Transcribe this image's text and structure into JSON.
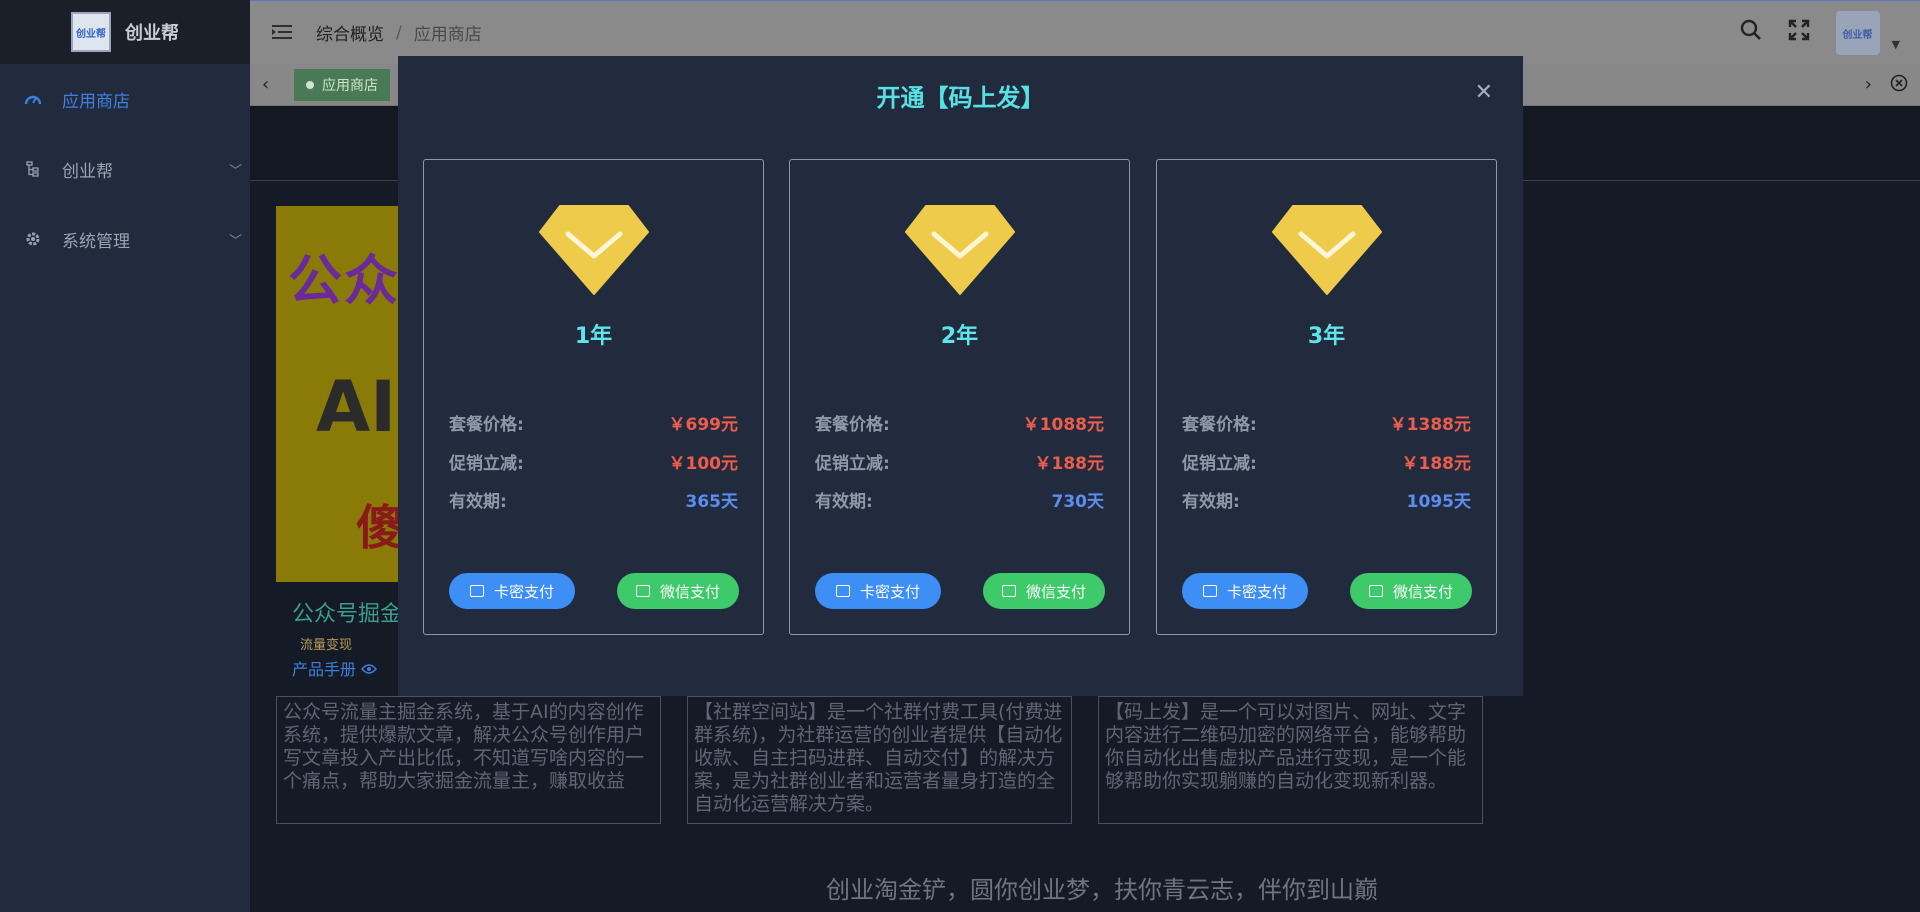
{
  "sidebar": {
    "logo_text": "创业帮",
    "logo_badge": "创业帮",
    "items": [
      {
        "label": "应用商店"
      },
      {
        "label": "创业帮"
      },
      {
        "label": "系统管理"
      }
    ]
  },
  "header": {
    "breadcrumb_home": "综合概览",
    "breadcrumb_sep": "/",
    "breadcrumb_current": "应用商店",
    "avatar_text": "创业帮"
  },
  "tabs": {
    "active_label": "应用商店"
  },
  "content": {
    "poster_line1": "公众号",
    "poster_line2": "AI",
    "poster_line3": "傻",
    "card_title": "公众号掘金",
    "card_tag": "流量变现",
    "card_manual": "产品手册",
    "descriptions": [
      "公众号流量主掘金系统，基于AI的内容创作系统，提供爆款文章，解决公众号创作用户写文章投入产出比低，不知道写啥内容的一个痛点，帮助大家掘金流量主，赚取收益",
      "【社群空间站】是一个社群付费工具(付费进群系统)，为社群运营的创业者提供【自动化收款、自主扫码进群、自动交付】的解决方案，是为社群创业者和运营者量身打造的全自动化运营解决方案。",
      "【码上发】是一个可以对图片、网址、文字内容进行二维码加密的网络平台，能够帮助你自动化出售虚拟产品进行变现，是一个能够帮助你实现躺赚的自动化变现新利器。"
    ],
    "slogan": "创业淘金铲，圆你创业梦，扶你青云志，伴你到山巅"
  },
  "modal": {
    "title": "开通【码上发】",
    "price_label": "套餐价格:",
    "discount_label": "促销立减:",
    "validity_label": "有效期:",
    "card_pay_label": "卡密支付",
    "wechat_pay_label": "微信支付",
    "plans": [
      {
        "year": "1年",
        "price": "￥699元",
        "discount": "￥100元",
        "validity": "365天"
      },
      {
        "year": "2年",
        "price": "￥1088元",
        "discount": "￥188元",
        "validity": "730天"
      },
      {
        "year": "3年",
        "price": "￥1388元",
        "discount": "￥188元",
        "validity": "1095天"
      }
    ]
  },
  "colors": {
    "accent_cyan": "#58e1e5",
    "price_red": "#ee5d4c",
    "validity_blue": "#5b8cf0",
    "card_pay_blue": "#3d8ef5",
    "wechat_green": "#3ec96a",
    "gem_gold": "#eecb4a"
  }
}
